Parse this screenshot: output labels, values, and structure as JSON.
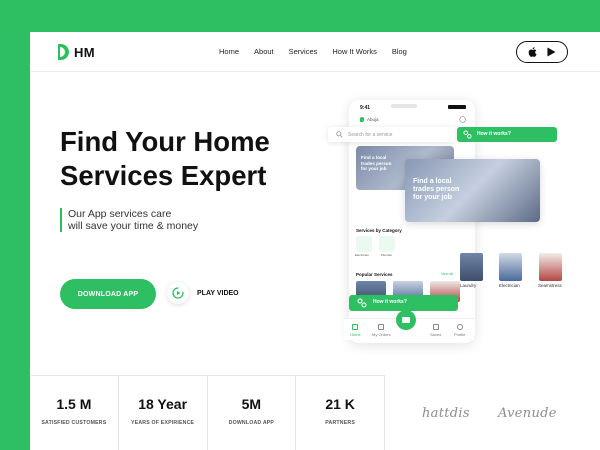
{
  "header": {
    "logo_text": "HM",
    "nav": [
      "Home",
      "About",
      "Services",
      "How It Works",
      "Blog"
    ],
    "store_icons": [
      "apple-icon",
      "play-store-icon"
    ]
  },
  "hero": {
    "title_line1": "Find Your Home",
    "title_line2": "Services Expert",
    "tagline_line1": "Our App services care",
    "tagline_line2": "will save your time & money",
    "download_label": "DOWNLOAD APP",
    "play_label": "PLAY VIDEO"
  },
  "phone": {
    "time": "9:41",
    "location": "Abuja",
    "search_placeholder": "Search for a service",
    "how_label": "How it works?",
    "banner_line1": "Find a local",
    "banner_line2": "trades person",
    "banner_line3": "for your job",
    "categories_title": "Services by Category",
    "categories": [
      "Electrician",
      "Plumber"
    ],
    "popular_title": "Popular Services",
    "view_all": "View all",
    "services": [
      "Laundry",
      "Electrician",
      "Seamstress"
    ],
    "tabs": [
      "Home",
      "My Orders",
      "Saved",
      "Profile"
    ]
  },
  "float": {
    "services": [
      "Laundry",
      "Electrician",
      "Seamstress"
    ]
  },
  "stats": [
    {
      "value": "1.5 M",
      "label": "SATISFIED CUSTOMERS"
    },
    {
      "value": "18 Year",
      "label": "YEARS OF EXPIRIENCE"
    },
    {
      "value": "5M",
      "label": "DOWNLOAD APP"
    },
    {
      "value": "21 K",
      "label": "PARTNERS"
    }
  ],
  "partners": [
    "hattdis",
    "Avenude"
  ],
  "colors": {
    "accent": "#2ebf62",
    "text": "#111111"
  }
}
